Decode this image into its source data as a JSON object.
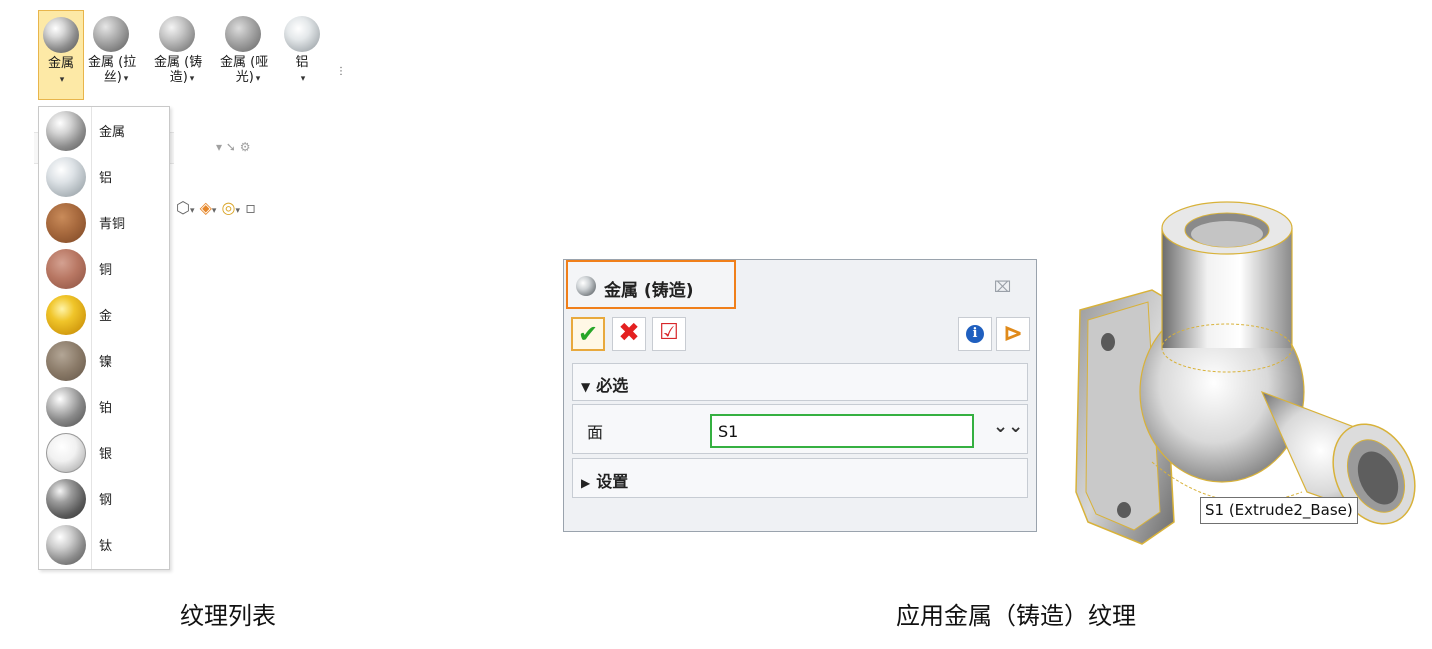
{
  "ribbon": {
    "items": [
      {
        "line1": "金属",
        "line2": "",
        "color": "metal",
        "active": true
      },
      {
        "line1": "金属 (拉",
        "line2": "丝)",
        "color": "brushed",
        "active": false
      },
      {
        "line1": "金属 (铸",
        "line2": "造)",
        "color": "cast",
        "active": false
      },
      {
        "line1": "金属 (哑",
        "line2": "光)",
        "color": "matte",
        "active": false
      },
      {
        "line1": "铝",
        "line2": "",
        "color": "aluminum",
        "active": false
      }
    ]
  },
  "dropdown": {
    "items": [
      {
        "label": "金属",
        "color": "#9a9a9a"
      },
      {
        "label": "铝",
        "color": "#b9c0c6"
      },
      {
        "label": "青铜",
        "color": "#a86a3e"
      },
      {
        "label": "铜",
        "color": "#b87763"
      },
      {
        "label": "金",
        "color": "#e2b219"
      },
      {
        "label": "镍",
        "color": "#8a7a68"
      },
      {
        "label": "铂",
        "color": "#8f8f8f"
      },
      {
        "label": "银",
        "color": "#c2c2c2"
      },
      {
        "label": "钢",
        "color": "#6e6e6e"
      },
      {
        "label": "钛",
        "color": "#9b9b9b"
      }
    ]
  },
  "dialog": {
    "title": "金属 (铸造)",
    "close_icon": "close-icon",
    "toolbar": {
      "ok_icon": "checkmark-icon",
      "cancel_icon": "x-icon",
      "apply_icon": "apply-check-icon",
      "info_icon": "info-icon",
      "side_icon": "panel-toggle-icon"
    },
    "required_section": {
      "label": "必选",
      "expanded": true
    },
    "face": {
      "label": "面",
      "value": "S1"
    },
    "settings_section": {
      "label": "设置",
      "expanded": false
    }
  },
  "part": {
    "tooltip": "S1 (Extrude2_Base)",
    "highlight_color": "#e8c13a"
  },
  "captions": {
    "left": "纹理列表",
    "right": "应用金属（铸造）纹理"
  },
  "colors": {
    "accent_orange": "#f07f1a",
    "selected_green": "#35b041",
    "ribbon_active": "#fde9a6"
  }
}
